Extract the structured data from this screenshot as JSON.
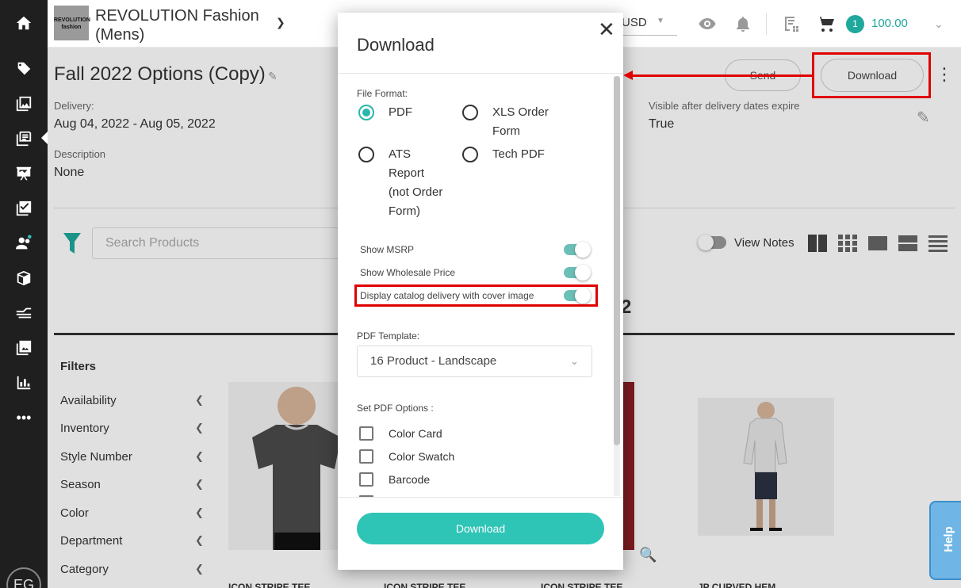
{
  "header": {
    "logo_text_1": "REVOLUTION",
    "logo_text_2": "fashion",
    "brand_line1": "REVOLUTION Fashion",
    "brand_line2": "(Mens)",
    "currency": "USD",
    "cart_count": "1",
    "cart_total": "100.00"
  },
  "page": {
    "title": "Fall 2022 Options (Copy)",
    "delivery_label": "Delivery:",
    "delivery_value": "Aug 04, 2022 - Aug 05, 2022",
    "description_label": "Description",
    "description_value": "None",
    "visible_label": "Visible after delivery dates expire",
    "visible_value": "True",
    "send_label": "Send",
    "download_label": "Download",
    "search_placeholder": "Search Products",
    "view_notes_label": "View Notes",
    "section_fragment": "2",
    "filters_title": "Filters",
    "filters": [
      "Availability",
      "Inventory",
      "Style Number",
      "Season",
      "Color",
      "Department",
      "Category"
    ],
    "products": [
      "ICON STRIPE TEE",
      "ICON STRIPE TEE",
      "ICON STRIPE TEE",
      "JP CURVED HEM"
    ],
    "help_label": "Help",
    "avatar_initials": "EG"
  },
  "modal": {
    "title": "Download",
    "file_format_label": "File Format:",
    "formats": [
      {
        "label": "PDF",
        "checked": true
      },
      {
        "label": "XLS Order Form",
        "checked": false
      },
      {
        "label": "ATS Report (not Order Form)",
        "checked": false
      },
      {
        "label": "Tech PDF",
        "checked": false
      }
    ],
    "toggles": [
      {
        "label": "Show MSRP",
        "on": true
      },
      {
        "label": "Show Wholesale Price",
        "on": true
      },
      {
        "label": "Display catalog delivery with cover image",
        "on": true
      }
    ],
    "pdf_template_label": "PDF Template:",
    "pdf_template_value": "16 Product - Landscape",
    "pdf_options_label": "Set PDF Options :",
    "pdf_options": [
      "Color Card",
      "Color Swatch",
      "Barcode"
    ],
    "download_button": "Download"
  },
  "colors": {
    "accent": "#2ec4b6",
    "annotation": "#e00000",
    "sidebar": "#1f1f1f"
  }
}
